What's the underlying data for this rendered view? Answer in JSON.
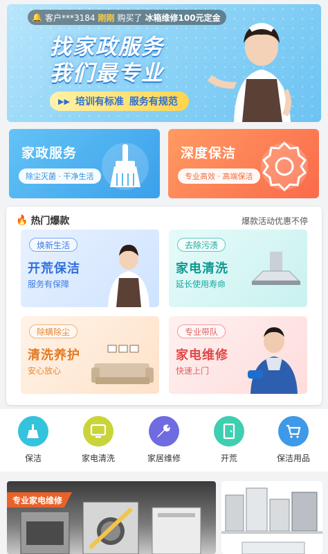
{
  "notice": {
    "prefix": "客户***3184",
    "highlight": "刚刚",
    "text": "购买了",
    "item": "冰箱维修100元定金"
  },
  "banner": {
    "line1": "找家政服务",
    "line2": "我们最专业",
    "tag1": "培训有标准",
    "tag2": "服务有规范"
  },
  "cards": [
    {
      "title": "家政服务",
      "pill": "除尘灭菌 · 干净生活",
      "icon": "broom-icon"
    },
    {
      "title": "深度保洁",
      "pill": "专业高效 · 高端保洁",
      "icon": "award-badge-icon"
    }
  ],
  "hot": {
    "title": "热门爆款",
    "subtitle": "爆款活动优惠不停",
    "tiles": [
      {
        "tag": "焕新生活",
        "title": "开荒保洁",
        "sub": "服务有保障"
      },
      {
        "tag": "去除污渍",
        "title": "家电清洗",
        "sub": "延长使用寿命"
      },
      {
        "tag": "除螨除尘",
        "title": "清洗养护",
        "sub": "安心放心"
      },
      {
        "tag": "专业带队",
        "title": "家电维修",
        "sub": "快速上门"
      }
    ]
  },
  "categories": [
    {
      "label": "保洁",
      "icon": "broom-icon",
      "color": "#34c3dc"
    },
    {
      "label": "家电清洗",
      "icon": "monitor-icon",
      "color": "#c9d43a"
    },
    {
      "label": "家居维修",
      "icon": "wrench-icon",
      "color": "#6f6be0"
    },
    {
      "label": "开荒",
      "icon": "door-icon",
      "color": "#3fcfb0"
    },
    {
      "label": "保洁用品",
      "icon": "cart-icon",
      "color": "#3e9ae8"
    }
  ],
  "promo": {
    "badge": "专业家电维修"
  },
  "colors": {
    "accent": "#3aa0ea",
    "orange": "#fb6a4a",
    "fire": "#f4452c"
  }
}
